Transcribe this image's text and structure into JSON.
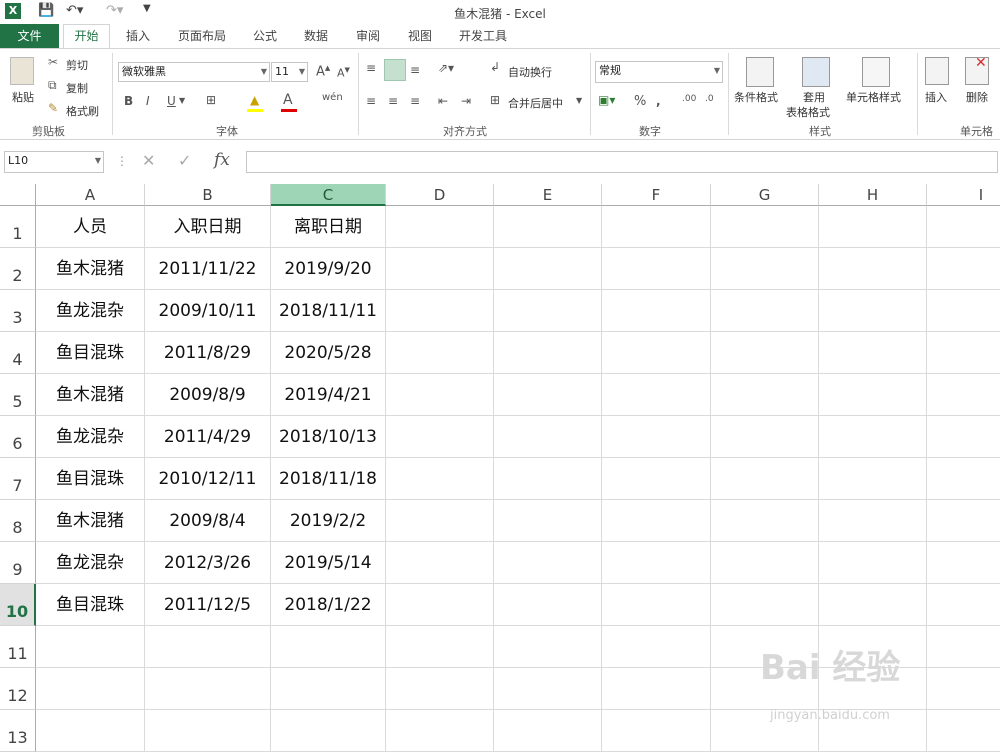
{
  "window": {
    "title": "鱼木混猪 - Excel"
  },
  "tabs": [
    "文件",
    "开始",
    "插入",
    "页面布局",
    "公式",
    "数据",
    "审阅",
    "视图",
    "开发工具"
  ],
  "ribbon": {
    "clipboard": {
      "paste": "粘贴",
      "cut": "剪切",
      "copy": "复制",
      "format_painter": "格式刷",
      "label": "剪贴板"
    },
    "font": {
      "name": "微软雅黑",
      "size": "11",
      "label": "字体"
    },
    "alignment": {
      "wrap": "自动换行",
      "merge": "合并后居中",
      "label": "对齐方式"
    },
    "number": {
      "format": "常规",
      "label": "数字"
    },
    "styles": {
      "conditional": "条件格式",
      "table1": "套用",
      "table2": "表格格式",
      "cell_styles": "单元格样式",
      "label": "样式"
    },
    "cells": {
      "insert": "插入",
      "delete": "删除",
      "label": "单元格"
    }
  },
  "formula_bar": {
    "name_box": "L10",
    "fx": "fx",
    "formula": ""
  },
  "grid": {
    "columns": [
      "A",
      "B",
      "C",
      "D",
      "E",
      "F",
      "G",
      "H",
      "I"
    ],
    "selected_column": "C",
    "selected_row": "10",
    "rows": [
      {
        "n": "1",
        "cells": [
          "人员",
          "入职日期",
          "离职日期"
        ]
      },
      {
        "n": "2",
        "cells": [
          "鱼木混猪",
          "2011/11/22",
          "2019/9/20"
        ]
      },
      {
        "n": "3",
        "cells": [
          "鱼龙混杂",
          "2009/10/11",
          "2018/11/11"
        ]
      },
      {
        "n": "4",
        "cells": [
          "鱼目混珠",
          "2011/8/29",
          "2020/5/28"
        ]
      },
      {
        "n": "5",
        "cells": [
          "鱼木混猪",
          "2009/8/9",
          "2019/4/21"
        ]
      },
      {
        "n": "6",
        "cells": [
          "鱼龙混杂",
          "2011/4/29",
          "2018/10/13"
        ]
      },
      {
        "n": "7",
        "cells": [
          "鱼目混珠",
          "2010/12/11",
          "2018/11/18"
        ]
      },
      {
        "n": "8",
        "cells": [
          "鱼木混猪",
          "2009/8/4",
          "2019/2/2"
        ]
      },
      {
        "n": "9",
        "cells": [
          "鱼龙混杂",
          "2012/3/26",
          "2019/5/14"
        ]
      },
      {
        "n": "10",
        "cells": [
          "鱼目混珠",
          "2011/12/5",
          "2018/1/22"
        ]
      },
      {
        "n": "11",
        "cells": [
          "",
          "",
          ""
        ]
      },
      {
        "n": "12",
        "cells": [
          "",
          "",
          ""
        ]
      },
      {
        "n": "13",
        "cells": [
          "",
          "",
          ""
        ]
      }
    ]
  },
  "watermark": {
    "brand": "Bai 经验",
    "url": "jingyan.baidu.com"
  },
  "colors": {
    "accent": "#217346",
    "selected_header": "#9fd5b7"
  }
}
